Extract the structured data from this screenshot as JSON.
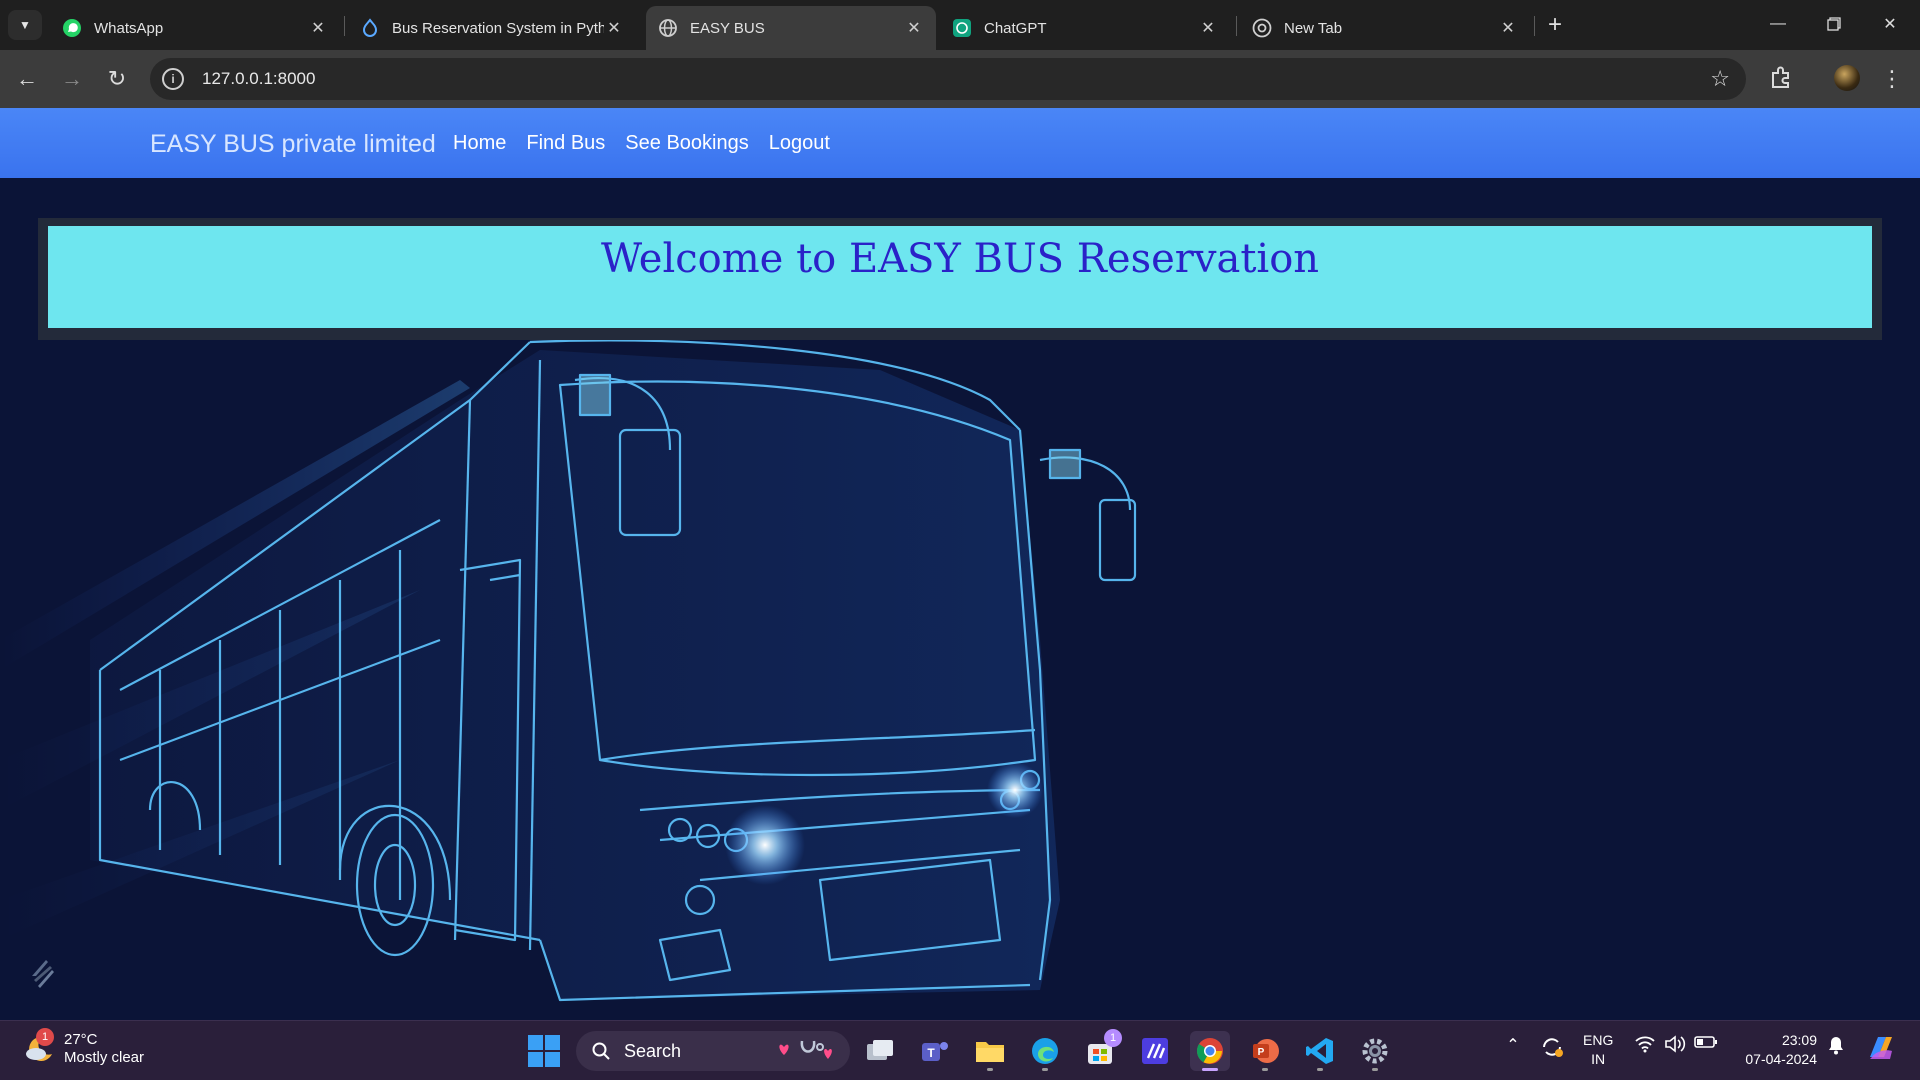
{
  "browser": {
    "tabs": [
      {
        "title": "WhatsApp",
        "icon": "whatsapp-icon",
        "active": false
      },
      {
        "title": "Bus Reservation System in Pyth",
        "icon": "drupal-icon",
        "active": false
      },
      {
        "title": "EASY BUS",
        "icon": "globe-icon",
        "active": true
      },
      {
        "title": "ChatGPT",
        "icon": "chatgpt-icon",
        "active": false
      },
      {
        "title": "New Tab",
        "icon": "chrome-icon",
        "active": false
      }
    ],
    "url": "127.0.0.1:8000"
  },
  "site": {
    "brand": "EASY BUS private limited",
    "nav": {
      "home": "Home",
      "find_bus": "Find Bus",
      "see_bookings": "See Bookings",
      "logout": "Logout"
    },
    "banner_title": "Welcome to EASY BUS Reservation",
    "colors": {
      "navbar": "#3a73ee",
      "banner": "#6ee6ef",
      "banner_text": "#2a22c8",
      "page_bg": "#0b1437"
    }
  },
  "taskbar": {
    "weather": {
      "temp": "27°C",
      "condition": "Mostly clear",
      "badge": "1"
    },
    "search_label": "Search",
    "store_badge": "1",
    "language": {
      "line1": "ENG",
      "line2": "IN"
    },
    "clock": {
      "time": "23:09",
      "date": "07-04-2024"
    }
  }
}
